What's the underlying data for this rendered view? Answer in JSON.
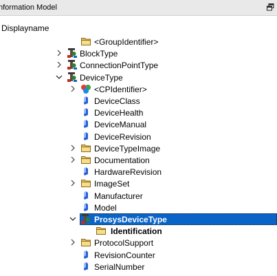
{
  "panel": {
    "title": "nformation Model"
  },
  "column": {
    "header": "Displayname"
  },
  "colors": {
    "selection": "#0a64c8",
    "folder": "#e8c15f",
    "variable": "#2a5fd6",
    "type_icon": "#5a4a3a"
  },
  "tree": [
    {
      "label": "<GroupIdentifier>",
      "icon": "folder-icon",
      "level": 1,
      "expander": "none"
    },
    {
      "label": "BlockType",
      "icon": "object-type-icon",
      "level": 0,
      "expander": "collapsed"
    },
    {
      "label": "ConnectionPointType",
      "icon": "object-type-icon",
      "level": 0,
      "expander": "collapsed"
    },
    {
      "label": "DeviceType",
      "icon": "object-type-icon",
      "level": 0,
      "expander": "expanded"
    },
    {
      "label": "<CPIdentifier>",
      "icon": "object-icon",
      "level": 1,
      "expander": "collapsed"
    },
    {
      "label": "DeviceClass",
      "icon": "variable-icon",
      "level": 1,
      "expander": "none"
    },
    {
      "label": "DeviceHealth",
      "icon": "variable-icon",
      "level": 1,
      "expander": "none"
    },
    {
      "label": "DeviceManual",
      "icon": "variable-icon",
      "level": 1,
      "expander": "none"
    },
    {
      "label": "DeviceRevision",
      "icon": "variable-icon",
      "level": 1,
      "expander": "none"
    },
    {
      "label": "DeviceTypeImage",
      "icon": "folder-icon",
      "level": 1,
      "expander": "collapsed"
    },
    {
      "label": "Documentation",
      "icon": "folder-icon",
      "level": 1,
      "expander": "collapsed"
    },
    {
      "label": "HardwareRevision",
      "icon": "variable-icon",
      "level": 1,
      "expander": "none"
    },
    {
      "label": "ImageSet",
      "icon": "folder-icon",
      "level": 1,
      "expander": "collapsed"
    },
    {
      "label": "Manufacturer",
      "icon": "variable-icon",
      "level": 1,
      "expander": "none"
    },
    {
      "label": "Model",
      "icon": "variable-icon",
      "level": 1,
      "expander": "none"
    },
    {
      "label": "ProsysDeviceType",
      "icon": "object-type-icon",
      "level": 1,
      "expander": "expanded",
      "selected": true
    },
    {
      "label": "Identification",
      "icon": "folder-icon",
      "level": 2,
      "expander": "none",
      "bold": true
    },
    {
      "label": "ProtocolSupport",
      "icon": "folder-icon",
      "level": 1,
      "expander": "collapsed"
    },
    {
      "label": "RevisionCounter",
      "icon": "variable-icon",
      "level": 1,
      "expander": "none"
    },
    {
      "label": "SerialNumber",
      "icon": "variable-icon",
      "level": 1,
      "expander": "none"
    }
  ]
}
